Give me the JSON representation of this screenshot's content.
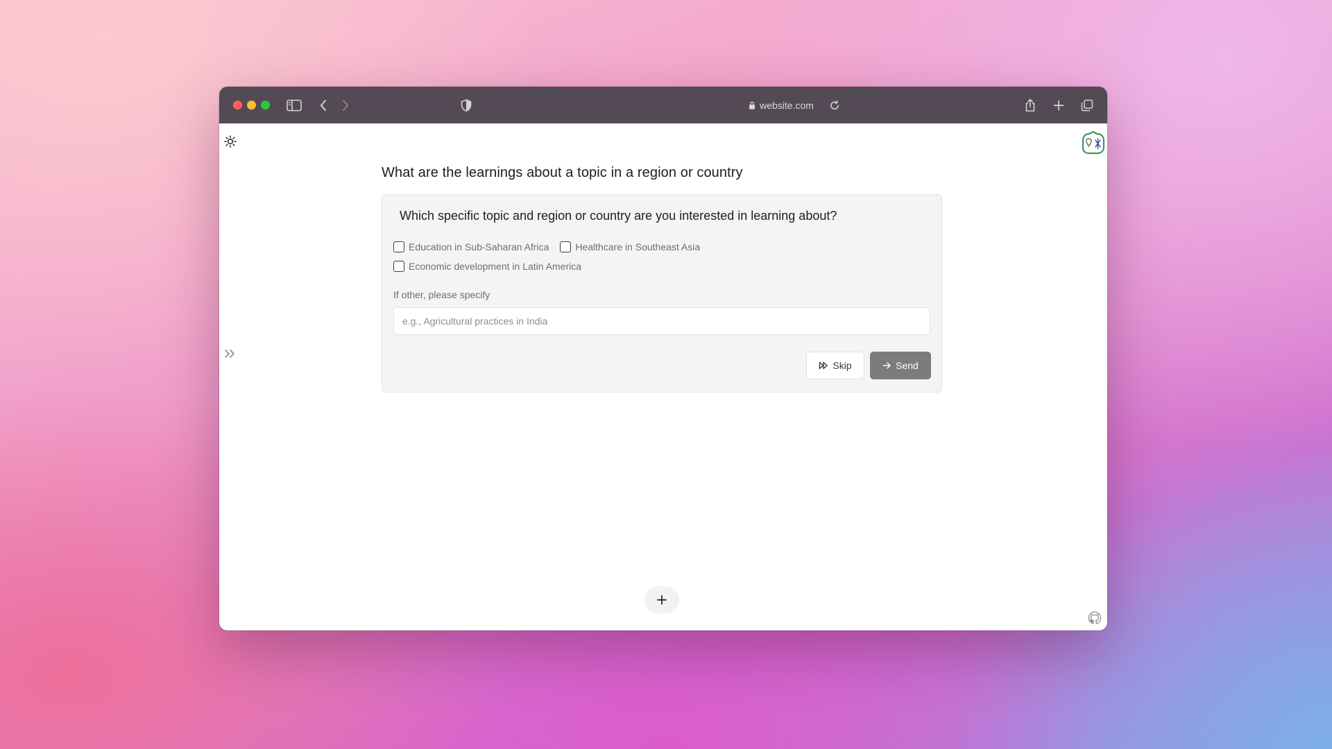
{
  "browser": {
    "url": "website.com"
  },
  "page": {
    "title": "What are the learnings about a topic in a region or country"
  },
  "card": {
    "question": "Which specific topic and region or country are you interested in learning about?",
    "options": [
      "Education in Sub-Saharan Africa",
      "Healthcare in Southeast Asia",
      "Economic development in Latin America"
    ],
    "other_label": "If other, please specify",
    "other_placeholder": "e.g., Agricultural practices in India",
    "skip_label": "Skip",
    "send_label": "Send"
  },
  "icons": {
    "theme": "sun-icon",
    "sidebar": "sidebar-icon",
    "back": "chevron-left-icon",
    "forward": "chevron-right-icon",
    "shield": "shield-icon",
    "lock": "lock-icon",
    "reload": "reload-icon",
    "share": "share-icon",
    "new_tab": "plus-icon",
    "tabs": "tabs-icon",
    "expand": "double-chevron-right-icon",
    "add": "plus-icon",
    "github": "github-icon",
    "logo": "app-logo-icon"
  },
  "colors": {
    "titlebar": "#544a55",
    "send_button": "#7c7c7e",
    "card_background": "#f4f4f4",
    "logo_accent": "#3a9a5b"
  }
}
